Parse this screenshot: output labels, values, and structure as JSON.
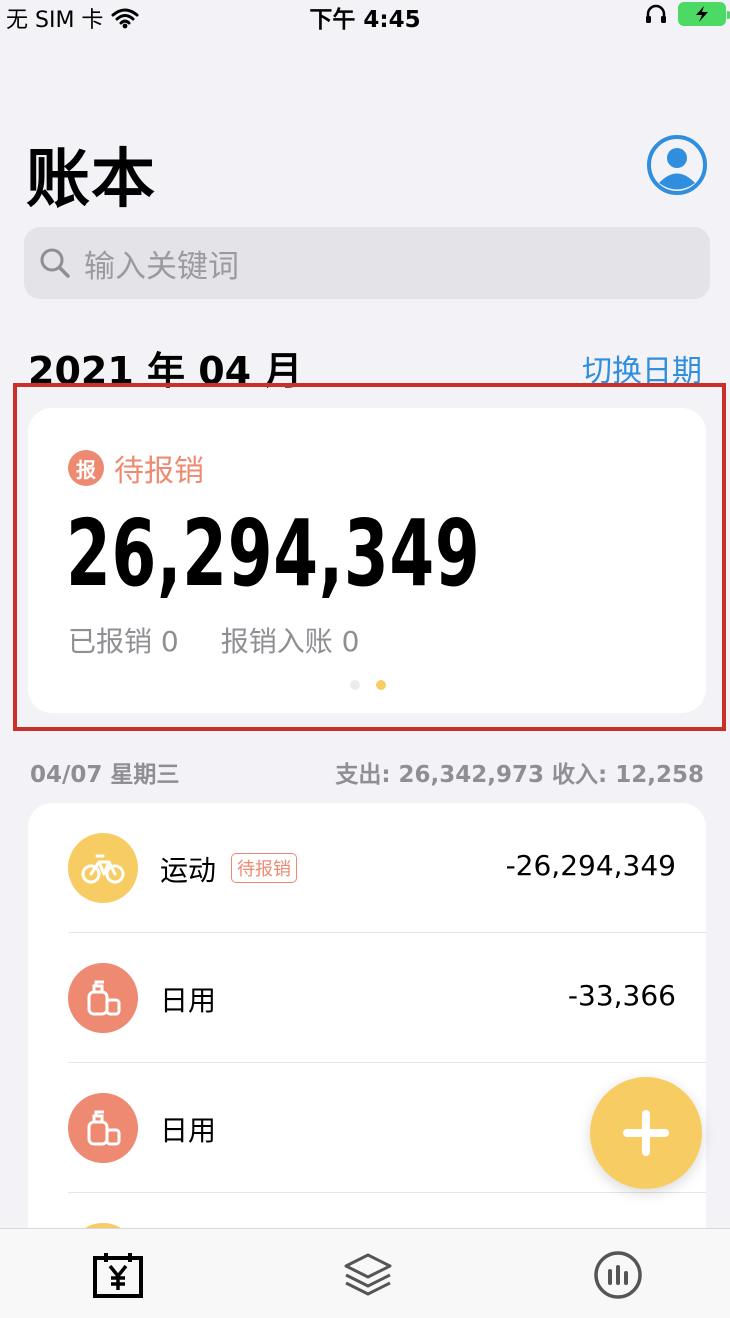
{
  "status_bar": {
    "carrier": "无 SIM 卡",
    "time": "下午 4:45"
  },
  "header": {
    "title": "账本",
    "avatar_icon": "person-circle-icon"
  },
  "search": {
    "placeholder": "输入关键词"
  },
  "period": {
    "label": "2021 年 04 月",
    "switch_label": "切换日期"
  },
  "summary_card": {
    "badge": "报",
    "label": "待报销",
    "amount": "26,294,349",
    "reimbursed": "已报销 0",
    "reimbursed_income": "报销入账 0",
    "page_index": 2,
    "page_count": 2
  },
  "day_group": {
    "date": "04/07 星期三",
    "summary": "支出: 26,342,973  收入: 12,258"
  },
  "transactions": [
    {
      "category": "运动",
      "tag": "待报销",
      "amount": "-26,294,349",
      "icon": "bicycle-icon",
      "color": "#f7cd63"
    },
    {
      "category": "日用",
      "tag": "",
      "amount": "-33,366",
      "icon": "daily-goods-icon",
      "color": "#ee8a72"
    },
    {
      "category": "日用",
      "tag": "",
      "amount": "",
      "icon": "daily-goods-icon",
      "color": "#ee8a72"
    }
  ],
  "colors": {
    "accent_blue": "#2f8fde",
    "pending_orange": "#ee8a72",
    "fab_yellow": "#f7cd63"
  },
  "tabs": [
    {
      "name": "ledger",
      "icon": "ledger-yen-icon",
      "active": true
    },
    {
      "name": "layers",
      "icon": "layers-icon",
      "active": false
    },
    {
      "name": "stats",
      "icon": "stats-icon",
      "active": false
    }
  ]
}
